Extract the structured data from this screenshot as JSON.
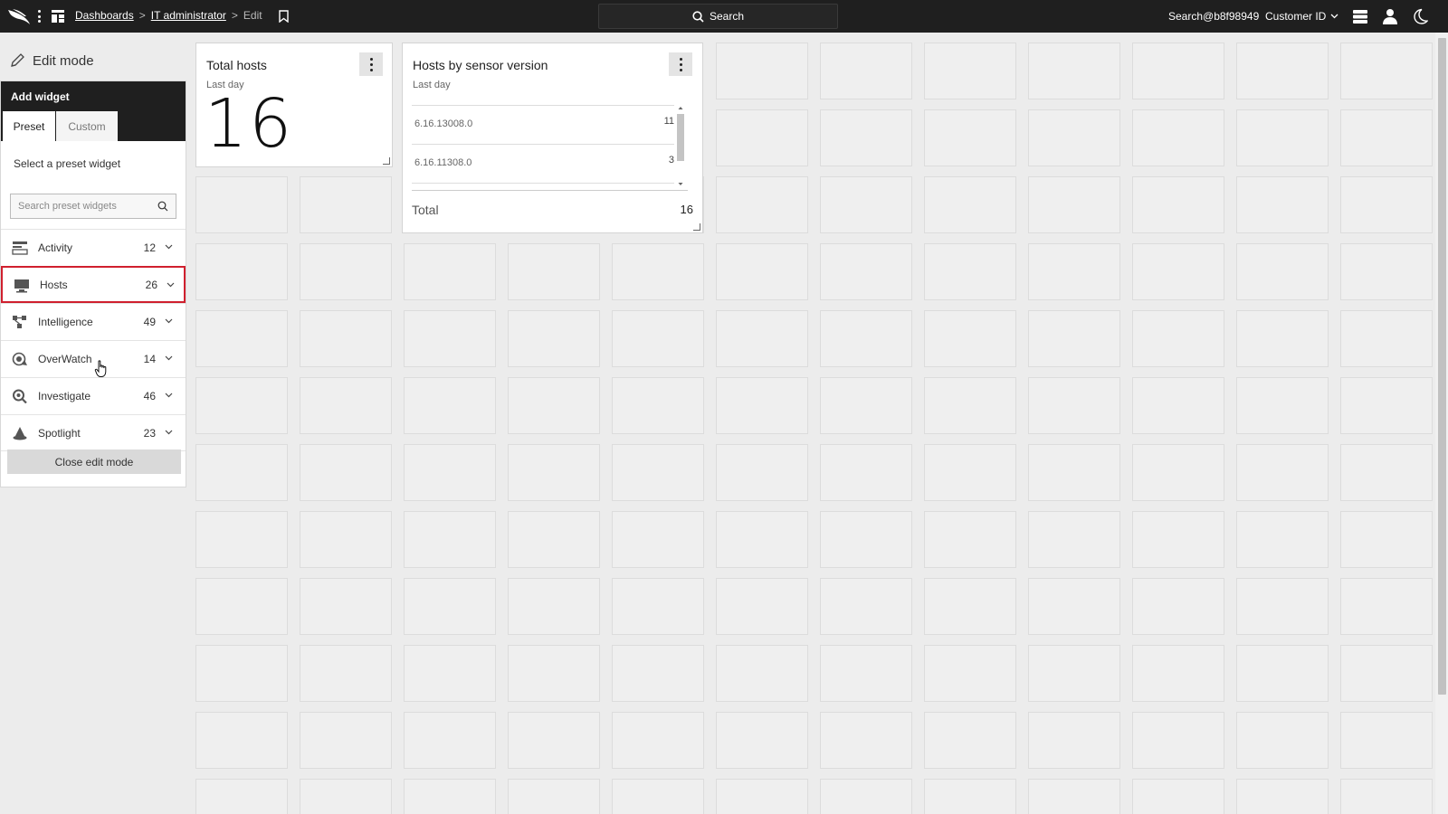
{
  "topbar": {
    "breadcrumbs": [
      "Dashboards",
      "IT administrator",
      "Edit"
    ],
    "search_label": "Search",
    "user": "Search@b8f98949",
    "customer_label": "Customer ID",
    "icons": [
      "falcon-logo-icon",
      "menu-dots-icon",
      "dashboard-grid-icon",
      "bookmark-icon",
      "search-icon",
      "chevron-down-icon",
      "servers-icon",
      "user-icon",
      "moon-icon"
    ]
  },
  "sidebar": {
    "edit_mode_label": "Edit mode",
    "add_widget_title": "Add widget",
    "tabs": [
      "Preset",
      "Custom"
    ],
    "select_label": "Select a preset widget",
    "search_placeholder": "Search preset widgets",
    "categories": [
      {
        "label": "Activity",
        "count": "12",
        "icon": "activity-icon"
      },
      {
        "label": "Hosts",
        "count": "26",
        "icon": "hosts-icon",
        "selected": true
      },
      {
        "label": "Intelligence",
        "count": "49",
        "icon": "intelligence-icon"
      },
      {
        "label": "OverWatch",
        "count": "14",
        "icon": "overwatch-icon"
      },
      {
        "label": "Investigate",
        "count": "46",
        "icon": "investigate-icon"
      },
      {
        "label": "Spotlight",
        "count": "23",
        "icon": "spotlight-icon"
      }
    ],
    "close_label": "Close edit mode"
  },
  "widgets": {
    "total_hosts": {
      "title": "Total hosts",
      "period": "Last day",
      "value": "16"
    },
    "sensor_version": {
      "title": "Hosts by sensor version",
      "period": "Last day",
      "rows": [
        {
          "version": "6.16.13008.0",
          "count": "11"
        },
        {
          "version": "6.16.11308.0",
          "count": "3"
        }
      ],
      "total_label": "Total",
      "total_value": "16"
    }
  },
  "colors": {
    "topbar_bg": "#1f1f1f",
    "selected_border": "#d0202e",
    "canvas_bg": "#ececec"
  }
}
